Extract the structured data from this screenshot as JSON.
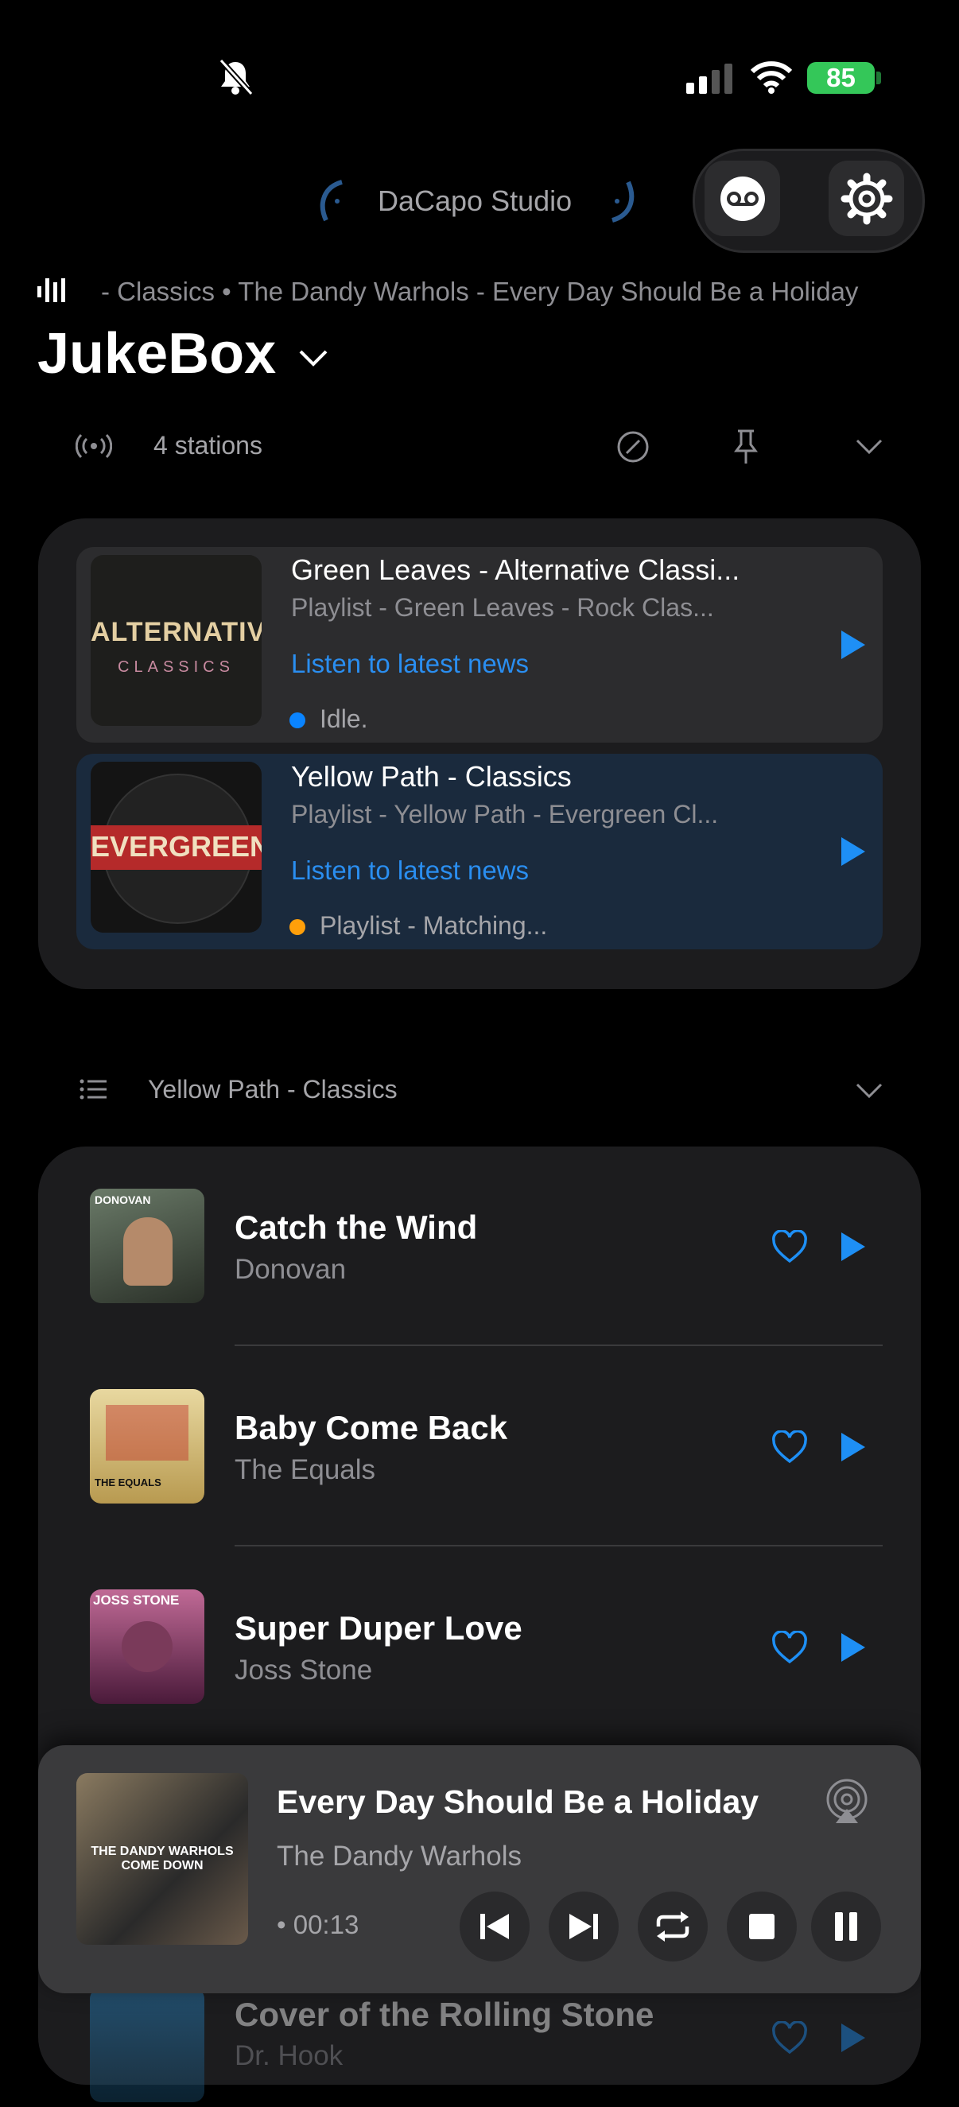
{
  "status_bar": {
    "battery": "85",
    "icons": [
      "bell-slash-icon",
      "signal-icon",
      "wifi-icon",
      "battery-charging-icon"
    ]
  },
  "header": {
    "studio_name": "DaCapo Studio",
    "icons": [
      "voicemail-icon",
      "gear-icon"
    ]
  },
  "now_ticker": "- Classics • The Dandy Warhols - Every Day Should Be a Holiday",
  "page_title": "JukeBox",
  "stations_bar": {
    "count_label": "4 stations"
  },
  "stations": [
    {
      "title": "Green Leaves - Alternative Classi...",
      "subtitle": "Playlist - Green Leaves - Rock Clas...",
      "link": "Listen to latest news",
      "status": "Idle.",
      "status_color": "#0a84ff",
      "art_top": "ALTERNATIVE",
      "art_bottom": "CLASSICS"
    },
    {
      "title": "Yellow Path - Classics",
      "subtitle": "Playlist - Yellow Path - Evergreen Cl...",
      "link": "Listen to latest news",
      "status": "Playlist - Matching...",
      "status_color": "#ff9f0a",
      "art_top": "EVERGREENS"
    }
  ],
  "playlist_bar": {
    "label": "Yellow Path - Classics"
  },
  "tracks": [
    {
      "title": "Catch the Wind",
      "artist": "Donovan",
      "art_label": "DONOVAN"
    },
    {
      "title": "Baby Come Back",
      "artist": "The Equals",
      "art_label": "THE EQUALS"
    },
    {
      "title": "Super Duper Love",
      "artist": "Joss Stone",
      "art_label": "JOSS STONE"
    },
    {
      "title": "Cover of the Rolling Stone",
      "artist": "Dr. Hook"
    }
  ],
  "player": {
    "title": "Every Day Should Be a Holiday",
    "artist": "The Dandy Warhols",
    "time": "• 00:13",
    "art_label": "THE DANDY WARHOLS COME DOWN"
  },
  "colors": {
    "accent": "#1e8ff5",
    "card": "#1c1c1e",
    "selected": "#1a2a3d"
  }
}
